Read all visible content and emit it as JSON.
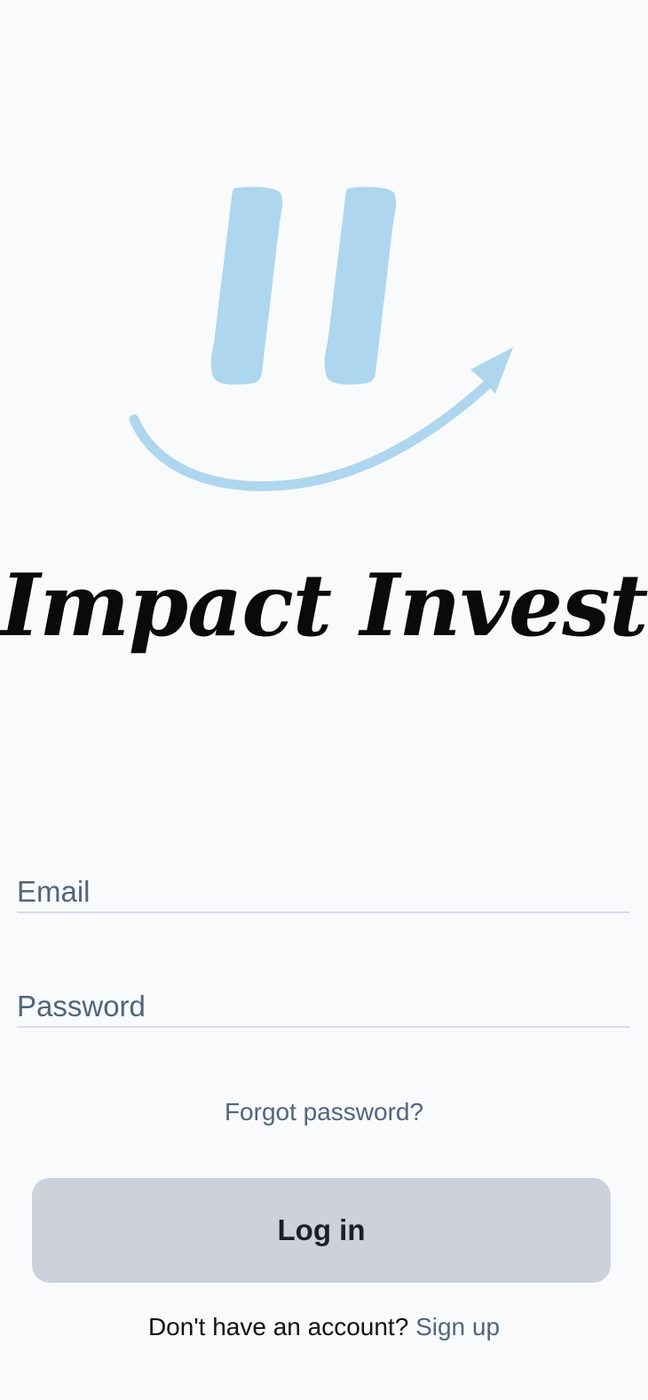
{
  "brand": {
    "name": "Impact Invest",
    "logo_color": "#AED6EE"
  },
  "form": {
    "email_placeholder": "Email",
    "password_placeholder": "Password",
    "forgot_password": "Forgot password?",
    "login_label": "Log in"
  },
  "footer": {
    "prompt": "Don't have an account?",
    "signup_label": "Sign up"
  },
  "colors": {
    "background": "#F9FAFC",
    "muted_text": "#51657C",
    "button_bg": "#CDD1DC"
  }
}
